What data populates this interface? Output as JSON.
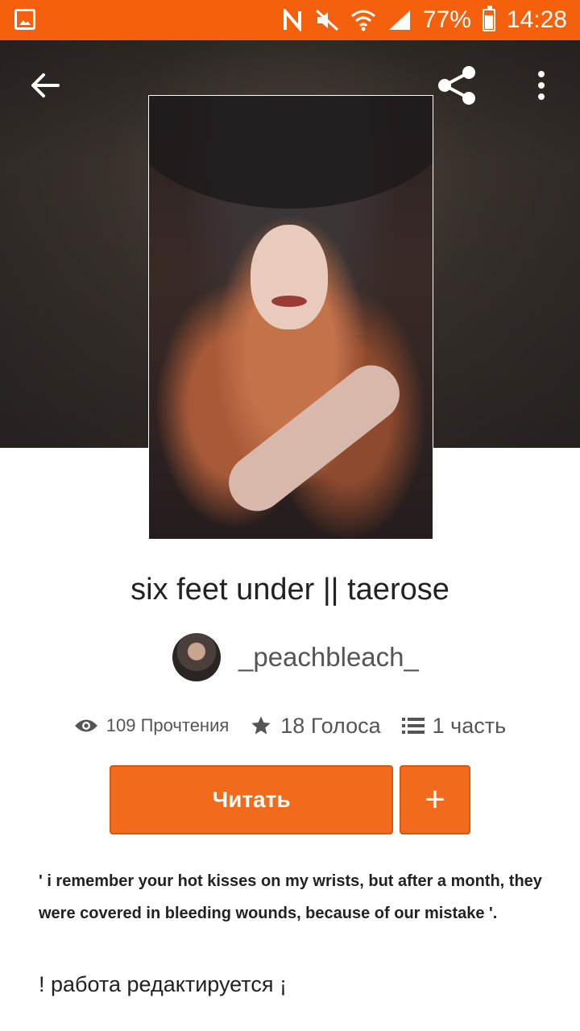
{
  "status_bar": {
    "battery": "77%",
    "time": "14:28",
    "icons": [
      "gallery-icon",
      "nfc-icon",
      "mute-icon",
      "wifi-icon",
      "signal-icon",
      "battery-icon"
    ]
  },
  "top_bar": {
    "icons": [
      "back-arrow-icon",
      "share-icon",
      "more-vert-icon"
    ]
  },
  "story": {
    "title": "six feet under || taerose",
    "author": "_peachbleach_",
    "stats": {
      "reads": "109 Прочтения",
      "votes": "18 Голоса",
      "parts": "1 часть"
    },
    "read_button": "Читать",
    "add_button": "+",
    "description": "' i remember your hot kisses on my wrists, but after a month, they were covered in bleeding wounds, because of our mistake '.",
    "status_note": "! работа редактируется ¡"
  },
  "colors": {
    "accent": "#f26b1d",
    "status_bar": "#f4600c"
  }
}
